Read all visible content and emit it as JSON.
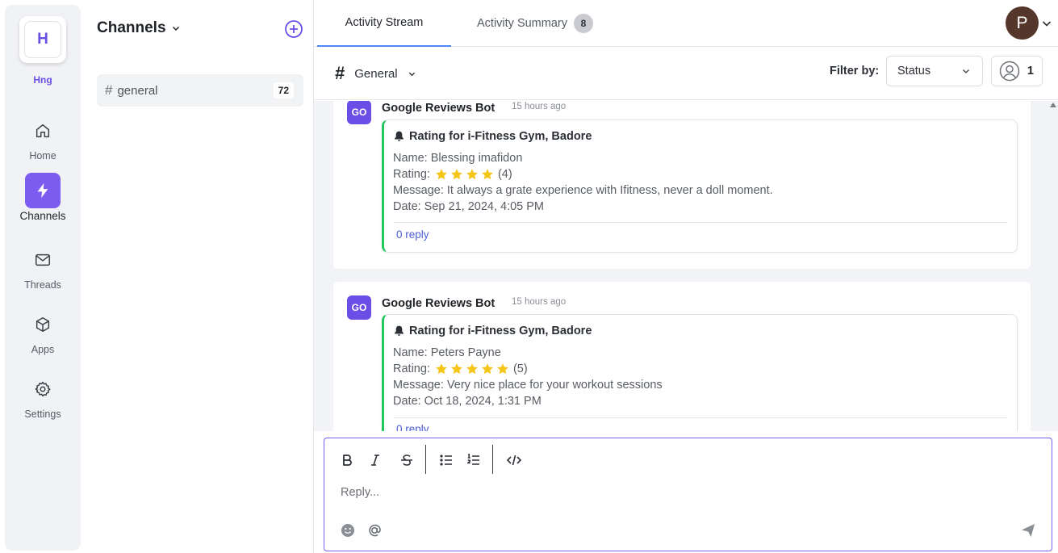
{
  "workspace": {
    "initial": "H",
    "name": "Hng"
  },
  "nav": {
    "home": "Home",
    "channels": "Channels",
    "threads": "Threads",
    "apps": "Apps",
    "settings": "Settings"
  },
  "channels_panel": {
    "title": "Channels",
    "items": [
      {
        "name": "general",
        "count": "72"
      }
    ]
  },
  "tabs": [
    {
      "label": "Activity Stream",
      "active": true
    },
    {
      "label": "Activity Summary",
      "badge": "8"
    }
  ],
  "user": {
    "initial": "P"
  },
  "toolbar": {
    "channel": "General",
    "filter_label": "Filter by:",
    "status_value": "Status",
    "user_count": "1"
  },
  "messages": [
    {
      "bot_initials": "GO",
      "bot_name": "Google Reviews Bot",
      "time": "15 hours ago",
      "title": "Rating for i-Fitness Gym, Badore",
      "name_line": "Name: Blessing imafidon",
      "rating_label": "Rating:",
      "stars": 4,
      "rating_value": "(4)",
      "message_line": "Message: It always a grate experience with Ifitness, never a doll moment.",
      "date_line": "Date: Sep 21, 2024, 4:05 PM",
      "reply": "0 reply"
    },
    {
      "bot_initials": "GO",
      "bot_name": "Google Reviews Bot",
      "time": "15 hours ago",
      "title": "Rating for i-Fitness Gym, Badore",
      "name_line": "Name: Peters Payne",
      "rating_label": "Rating:",
      "stars": 5,
      "rating_value": "(5)",
      "message_line": "Message: Very nice place for your workout sessions",
      "date_line": "Date: Oct 18, 2024, 1:31 PM",
      "reply": "0 reply"
    }
  ],
  "composer": {
    "placeholder": "Reply..."
  },
  "colors": {
    "accent": "#7b5cf0",
    "bot": "#6b4ee6",
    "card_border": "#22c55e",
    "star": "#f5c518",
    "link": "#4b5ed6"
  }
}
